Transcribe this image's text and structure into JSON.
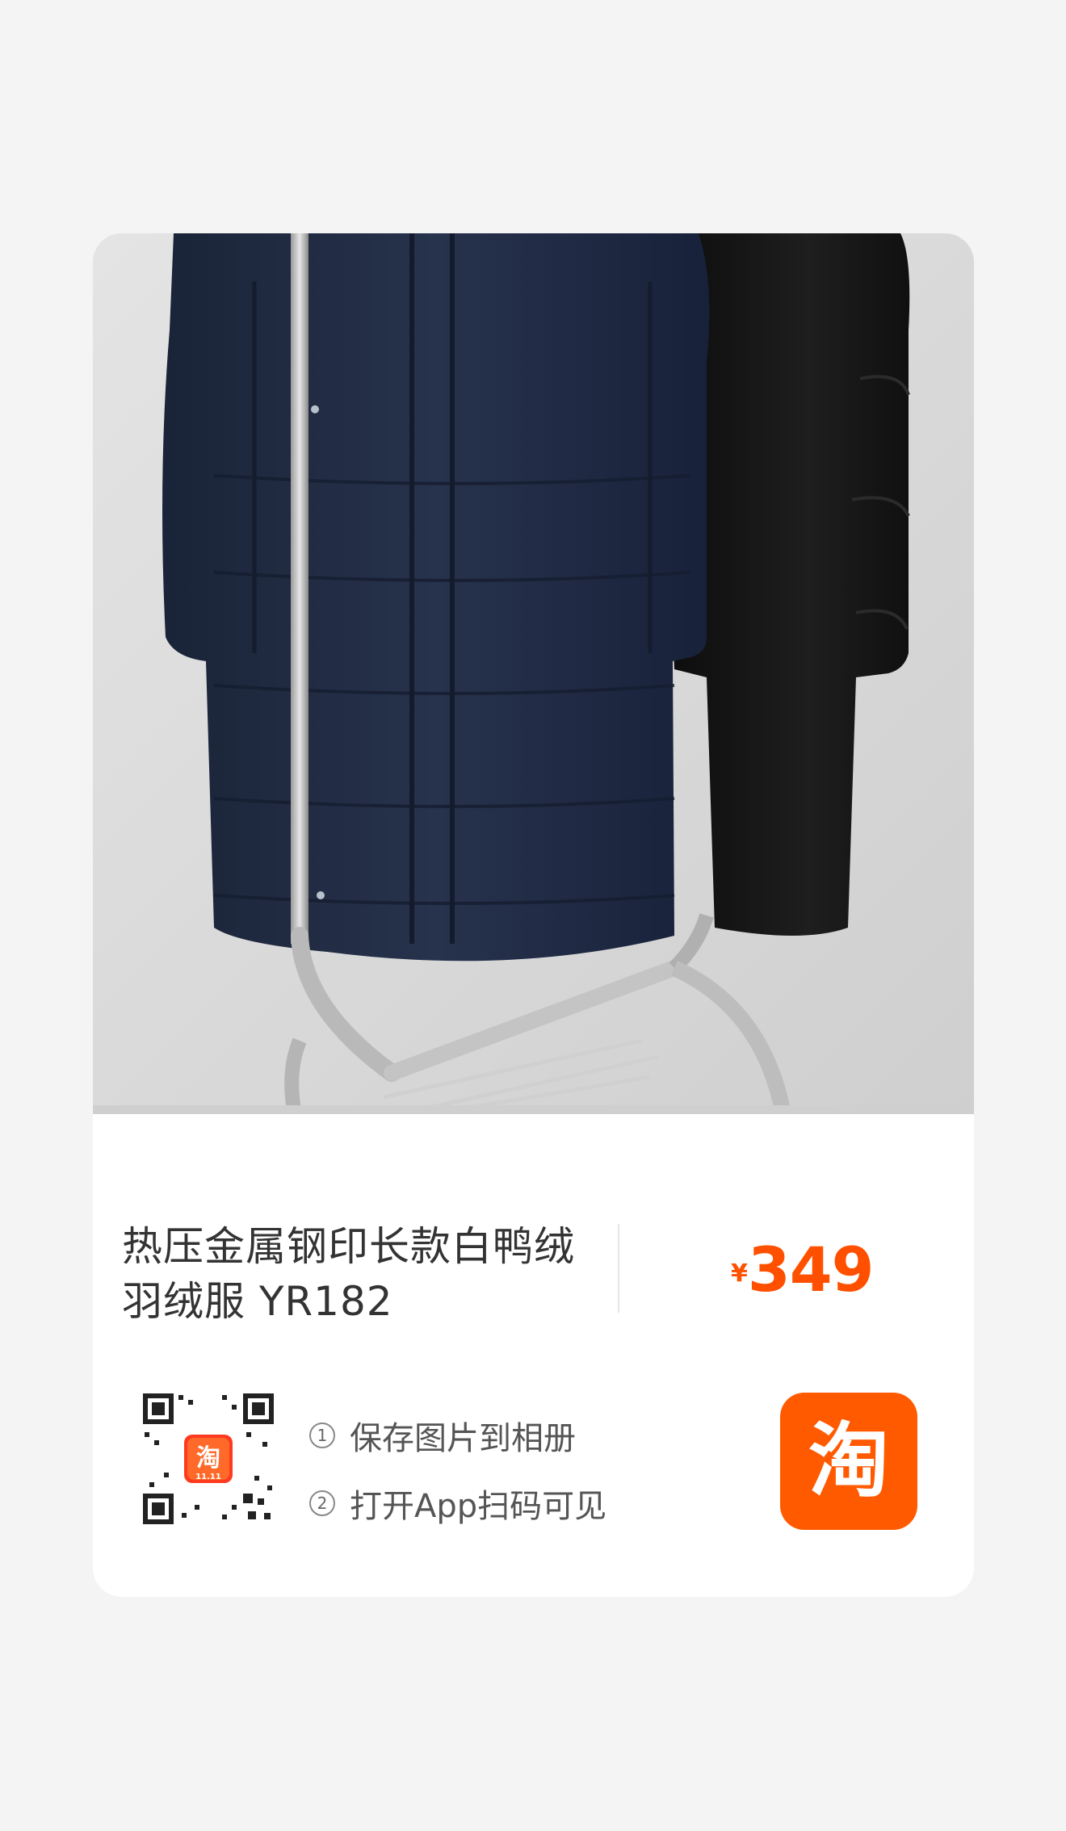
{
  "product": {
    "title": "热压金属钢印长款白鸭绒羽绒服 YR182",
    "currency_symbol": "¥",
    "price": "349"
  },
  "share": {
    "steps": [
      {
        "number": "1",
        "text": "保存图片到相册"
      },
      {
        "number": "2",
        "text": "打开App扫码可见"
      }
    ],
    "qr_badge_text": "淘",
    "qr_badge_sub": "11.11",
    "app_logo_text": "淘"
  },
  "colors": {
    "price": "#ff5000",
    "brand": "#ff5a00",
    "coat_navy": "#1f2a42",
    "coat_black": "#141414"
  },
  "icons": {
    "qr": "qr-code-icon",
    "app_logo": "taobao-logo-icon"
  }
}
